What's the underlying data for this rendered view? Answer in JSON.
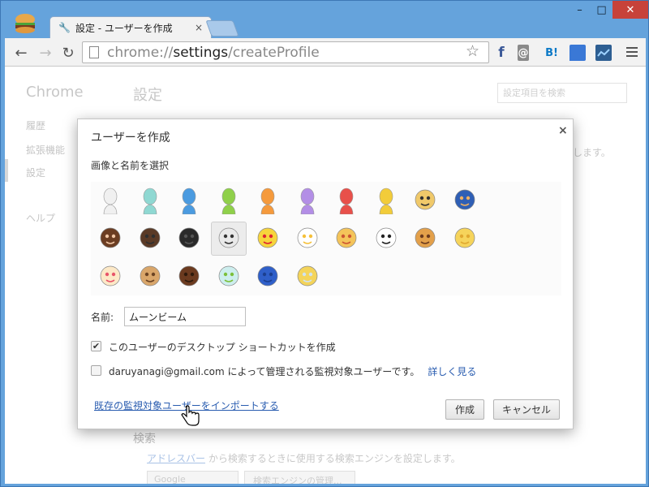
{
  "window": {
    "tab_title": "設定 - ユーザーを作成",
    "tab_close": "×",
    "minimize": "–",
    "maximize": "□",
    "close": "✕"
  },
  "toolbar": {
    "back": "←",
    "forward": "→",
    "reload": "↻",
    "url_scheme": "chrome://",
    "url_host": "settings",
    "url_path": "/createProfile",
    "star": "☆",
    "extensions": [
      {
        "name": "facebook-icon",
        "glyph": "f",
        "color": "#3b5998"
      },
      {
        "name": "evernote-icon",
        "glyph": "@",
        "color": "#888888"
      },
      {
        "name": "hatena-bookmark-icon",
        "glyph": "B!",
        "color": "#0b79c7"
      },
      {
        "name": "chat-icon",
        "glyph": "",
        "color": "#3a78d6"
      },
      {
        "name": "screenshot-icon",
        "glyph": "",
        "color": "#2d5e92"
      }
    ]
  },
  "page": {
    "brand": "Chrome",
    "title": "設定",
    "sidebar": [
      "履歴",
      "拡張機能",
      "設定",
      "ヘルプ"
    ],
    "search_placeholder": "設定項目を検索",
    "trailing_text": "します。",
    "search_section_title": "検索",
    "search_line_link": "アドレスバー",
    "search_line_rest": " から検索するときに使用する検索エンジンを設定します。",
    "engine_select": "Google",
    "manage_engines": "検索エンジンの管理..."
  },
  "dialog": {
    "title": "ユーザーを作成",
    "close": "×",
    "subtitle": "画像と名前を選択",
    "avatars": [
      "avatar-white-icon",
      "avatar-teal-icon",
      "avatar-blue-icon",
      "avatar-green-icon",
      "avatar-orange-icon",
      "avatar-purple-icon",
      "avatar-red-icon",
      "avatar-yellow-icon",
      "avatar-secret-agent-icon",
      "avatar-superhero-icon",
      "avatar-volleyball-icon",
      "avatar-businessman-icon",
      "avatar-ninja-icon",
      "avatar-alien-icon",
      "avatar-awesome-icon",
      "avatar-flower-icon",
      "avatar-pizza-icon",
      "avatar-soccer-icon",
      "avatar-burger-icon",
      "avatar-cat-icon",
      "avatar-cupcake-icon",
      "avatar-dog-icon",
      "avatar-horse-icon",
      "avatar-margarita-icon",
      "avatar-note-icon",
      "avatar-sun-cloud-icon"
    ],
    "selected_avatar": "avatar-alien-icon",
    "name_label": "名前:",
    "name_value": "ムーンビーム",
    "shortcut_checked": "✔",
    "shortcut_label": "このユーザーのデスクトップ ショートカットを作成",
    "supervised_label": "daruyanagi@gmail.com によって管理される監視対象ユーザーです。",
    "learn_more": "詳しく見る",
    "import_link": "既存の監視対象ユーザーをインポートする",
    "create_button": "作成",
    "cancel_button": "キャンセル"
  }
}
